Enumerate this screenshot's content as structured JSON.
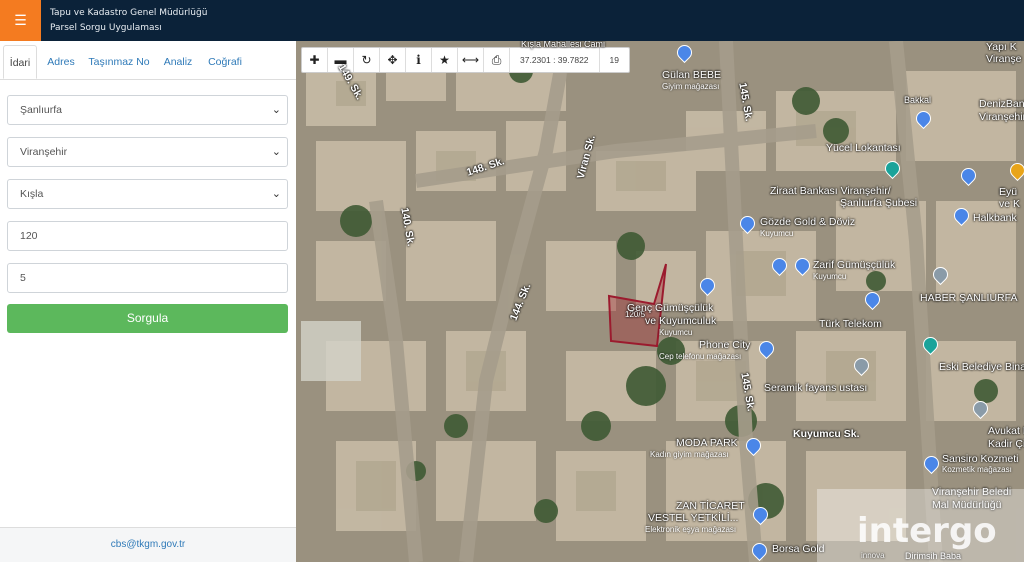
{
  "header": {
    "menu_icon": "hamburger-icon",
    "title_line1": "Tapu ve Kadastro Genel Müdürlüğü",
    "title_line2": "Parsel Sorgu Uygulaması",
    "accent": "#f47b20",
    "bg": "#0b2239"
  },
  "tabs": [
    {
      "label": "İdari"
    },
    {
      "label": "Adres"
    },
    {
      "label": "Taşınmaz No"
    },
    {
      "label": "Analiz"
    },
    {
      "label": "Coğrafi"
    }
  ],
  "form": {
    "province": "Şanlıurfa",
    "district": "Viranşehir",
    "neighborhood": "Kışla",
    "block": "120",
    "parcel": "5",
    "submit_label": "Sorgula",
    "submit_color": "#5cb85c"
  },
  "footer": {
    "email": "cbs@tkgm.gov.tr"
  },
  "map": {
    "coordinates": "37.2301 : 39.7822",
    "zoom": "19",
    "parcel_label": "120/5",
    "labels": {
      "kisla_mahallesi": "Kışla Mahallesi Cami",
      "gulan_bebe": "Gülan BEBE",
      "gulan_bebe_sub": "Giyim mağazası",
      "yucel": "Yücel Lokantası",
      "ziraat": "Ziraat Bankası Viranşehir/",
      "ziraat2": "Şanlıurfa Şubesi",
      "gozde": "Gözde Gold & Döviz",
      "gozde_sub": "Kuyumcu",
      "zarif": "Zarif Gümüşçülük",
      "zarif_sub": "Kuyumcu",
      "genc": "Genç Gümüşçülük",
      "genc2": "ve Kuyumculuk",
      "genc_sub": "Kuyumcu",
      "phone": "Phone City",
      "phone_sub": "Cep telefonu mağazası",
      "turk_telekom": "Türk Telekom",
      "haber": "HABER ŞANLIURFA",
      "eski": "Eski Belediye Binası",
      "seramik": "Seramik fayans ustası",
      "kuyumcu_sk": "Kuyumcu Sk.",
      "avukat": "Avukat Muh",
      "avukat2": "Kadir Çiftçi",
      "sansiro": "Sansiro Kozmeti",
      "sansiro_sub": "Kozmetik mağazası",
      "moda": "MODA PARK",
      "moda_sub": "Kadın giyim mağazası",
      "zan": "ZAN TİCARET",
      "zan2": "VESTEL YETKİLİ...",
      "zan_sub": "Elektronik eşya mağazası",
      "borsa": "Borsa Gold",
      "denizbank": "DenizBank",
      "denizbank2": "Viranşehir Şub",
      "bakkal": "Bakkal",
      "halkbank": "Halkbank",
      "eyup": "Eyü",
      "eyup2": "ve K",
      "viransehir_bel": "Viranşehir Beledi",
      "viransehir_bel2": "Mal Müdürlüğü",
      "yapi": "Yapı K",
      "yapi2": "Viranşe",
      "dirimsih": "Dirimsih Baba"
    },
    "roads": {
      "r149": "149. Sk.",
      "r148": "148. Sk.",
      "r140": "140. Sk.",
      "r144": "144. Sk.",
      "r145a": "145. Sk.",
      "r145b": "145. Sk.",
      "viran": "Viran Sk."
    },
    "watermark": "intergo",
    "watermark_sub": "innova"
  }
}
